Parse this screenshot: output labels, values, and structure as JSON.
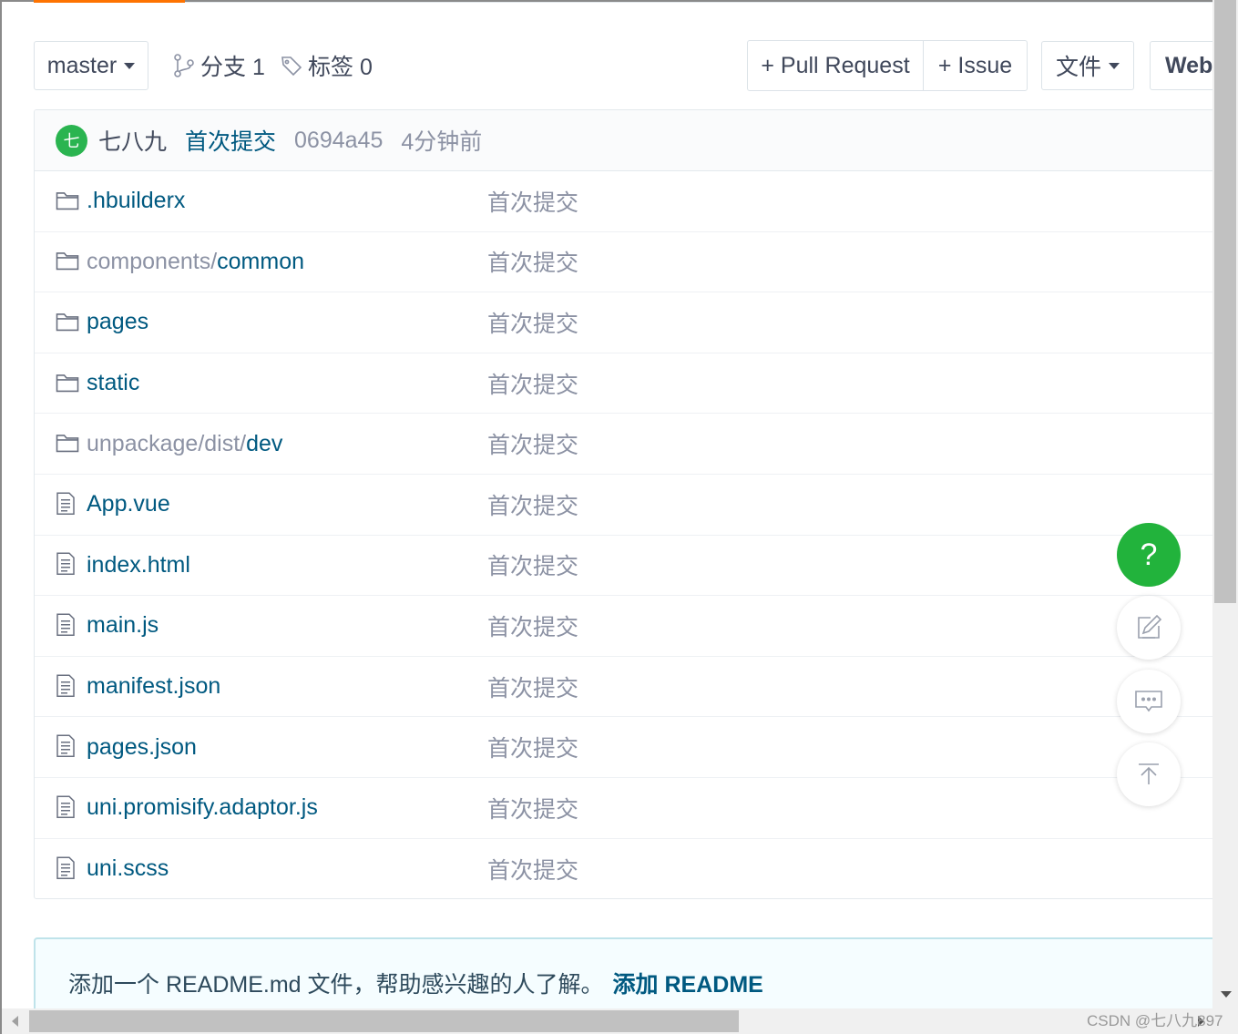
{
  "toolbar": {
    "branch_selector": "master",
    "branches_label": "分支 1",
    "tags_label": "标签 0",
    "pull_request_label": "+ Pull Request",
    "issue_label": "+ Issue",
    "files_label": "文件",
    "web_label": "Web"
  },
  "commit": {
    "avatar_letter": "七",
    "author": "七八九",
    "message": "首次提交",
    "hash": "0694a45",
    "time": "4分钟前"
  },
  "files": [
    {
      "type": "folder",
      "name": ".hbuilderx",
      "message": "首次提交"
    },
    {
      "type": "folder",
      "prefix": "components/",
      "last": "common",
      "message": "首次提交"
    },
    {
      "type": "folder",
      "name": "pages",
      "message": "首次提交"
    },
    {
      "type": "folder",
      "name": "static",
      "message": "首次提交"
    },
    {
      "type": "folder",
      "prefix": "unpackage/dist/",
      "last": "dev",
      "message": "首次提交"
    },
    {
      "type": "file",
      "name": "App.vue",
      "message": "首次提交"
    },
    {
      "type": "file",
      "name": "index.html",
      "message": "首次提交"
    },
    {
      "type": "file",
      "name": "main.js",
      "message": "首次提交"
    },
    {
      "type": "file",
      "name": "manifest.json",
      "message": "首次提交"
    },
    {
      "type": "file",
      "name": "pages.json",
      "message": "首次提交"
    },
    {
      "type": "file",
      "name": "uni.promisify.adaptor.js",
      "message": "首次提交"
    },
    {
      "type": "file",
      "name": "uni.scss",
      "message": "首次提交"
    }
  ],
  "readme": {
    "text": "添加一个 README.md 文件，帮助感兴趣的人了解。",
    "link": "添加 README"
  },
  "fab": {
    "help": "?"
  },
  "watermark": "CSDN @七八九897",
  "colors": {
    "accent": "#fe7300",
    "link": "#005980",
    "help_green": "#22b33c",
    "avatar_green": "#2ab450"
  }
}
